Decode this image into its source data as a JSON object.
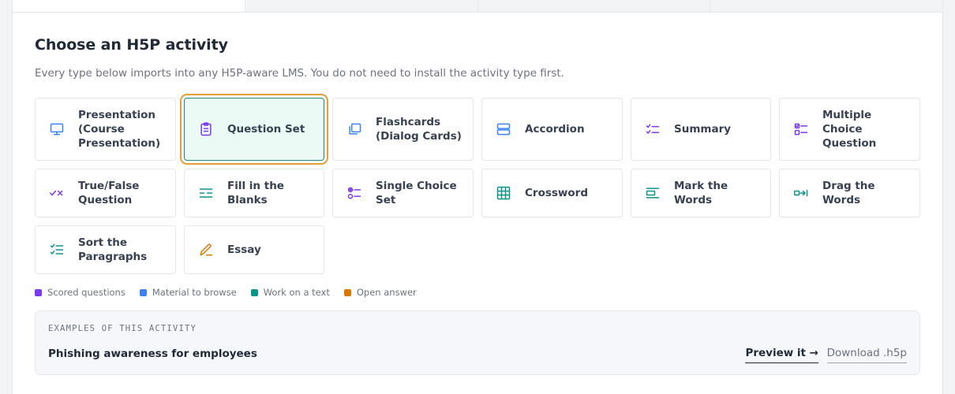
{
  "header": {
    "title": "Choose an H5P activity",
    "subtitle": "Every type below imports into any H5P-aware LMS. You do not need to install the activity type first."
  },
  "colors": {
    "scored": "#7c3aed",
    "material": "#3b82f6",
    "text": "#0d9488",
    "open": "#d97706",
    "selected_border": "#e3a036",
    "selected_fill": "#ecfaf5"
  },
  "activities": [
    {
      "label": "Presentation (Course Presentation)",
      "icon": "monitor-icon",
      "category": "material"
    },
    {
      "label": "Question Set",
      "icon": "clipboard-icon",
      "category": "scored",
      "selected": true
    },
    {
      "label": "Flashcards (Dialog Cards)",
      "icon": "cards-icon",
      "category": "material"
    },
    {
      "label": "Accordion",
      "icon": "accordion-icon",
      "category": "material"
    },
    {
      "label": "Summary",
      "icon": "checklist-icon",
      "category": "scored"
    },
    {
      "label": "Multiple Choice Question",
      "icon": "multiple-choice-icon",
      "category": "scored"
    },
    {
      "label": "True/False Question",
      "icon": "check-cross-icon",
      "category": "scored"
    },
    {
      "label": "Fill in the Blanks",
      "icon": "blanks-icon",
      "category": "text"
    },
    {
      "label": "Single Choice Set",
      "icon": "single-choice-icon",
      "category": "scored"
    },
    {
      "label": "Crossword",
      "icon": "grid-icon",
      "category": "text"
    },
    {
      "label": "Mark the Words",
      "icon": "mark-words-icon",
      "category": "text"
    },
    {
      "label": "Drag the Words",
      "icon": "drag-arrow-icon",
      "category": "text"
    },
    {
      "label": "Sort the Paragraphs",
      "icon": "sort-list-icon",
      "category": "text"
    },
    {
      "label": "Essay",
      "icon": "pencil-icon",
      "category": "open"
    }
  ],
  "legend": [
    {
      "label": "Scored questions",
      "color": "#7c3aed"
    },
    {
      "label": "Material to browse",
      "color": "#3b82f6"
    },
    {
      "label": "Work on a text",
      "color": "#0d9488"
    },
    {
      "label": "Open answer",
      "color": "#d97706"
    }
  ],
  "examples": {
    "heading": "EXAMPLES OF THIS ACTIVITY",
    "title": "Phishing awareness for employees",
    "preview_label": "Preview it →",
    "download_label": "Download .h5p"
  }
}
